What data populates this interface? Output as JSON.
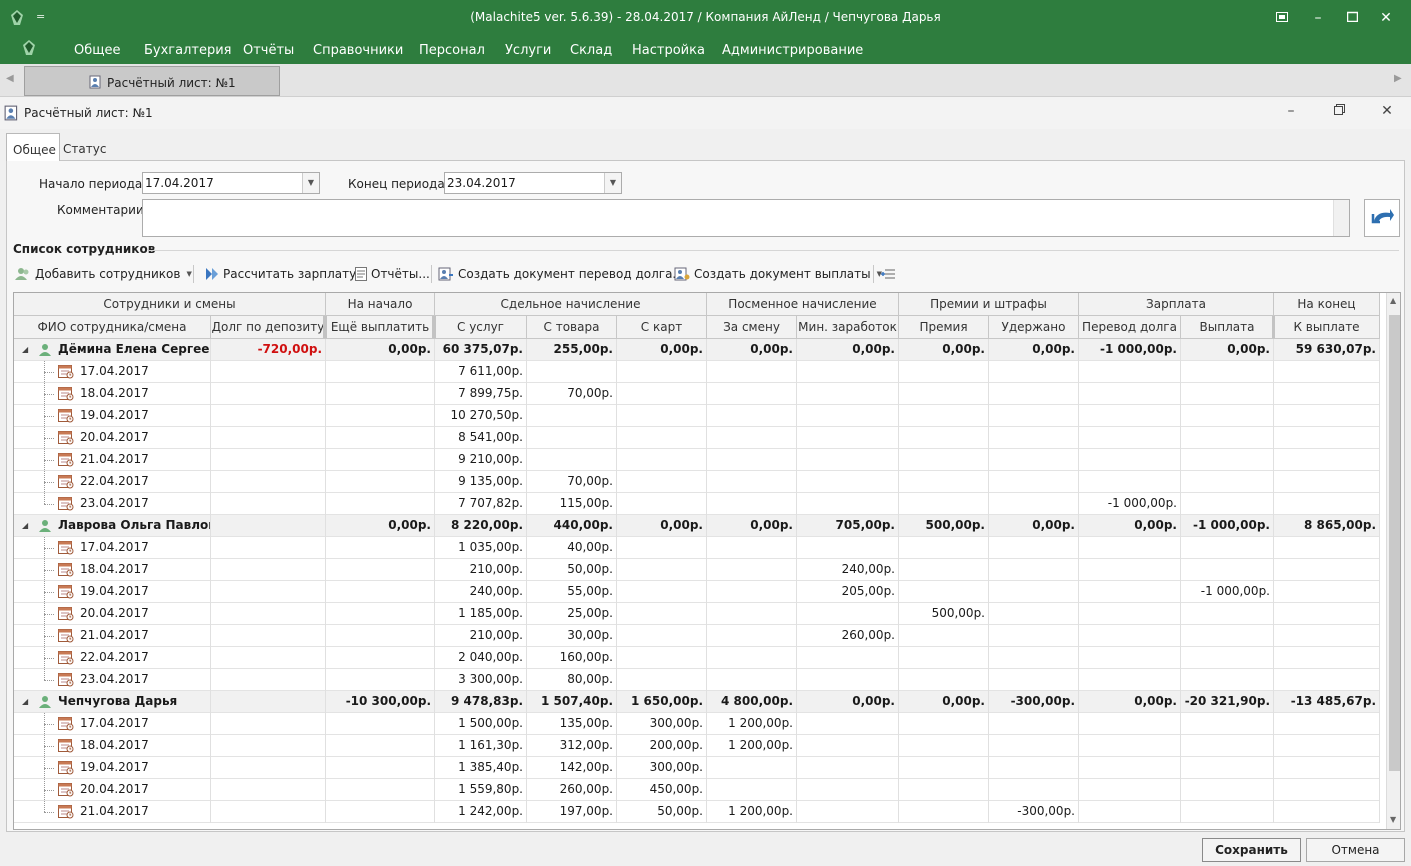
{
  "window": {
    "title": "(Malachite5 ver. 5.6.39) - 28.04.2017 / Компания АйЛенд / Чепчугова Дарья",
    "quick_access": "="
  },
  "menu": [
    "Общее",
    "Бухгалтерия",
    "Отчёты",
    "Справочники",
    "Персонал",
    "Услуги",
    "Склад",
    "Настройка",
    "Администрирование"
  ],
  "doc_tab": {
    "label": "Расчётный лист: №1"
  },
  "form": {
    "title": "Расчётный лист: №1",
    "tabs": [
      "Общее",
      "Статус"
    ],
    "start_label": "Начало периода:",
    "start_value": "17.04.2017",
    "end_label": "Конец периода:",
    "end_value": "23.04.2017",
    "comment_label": "Комментарии:",
    "comment_value": "",
    "section_title": "Список сотрудников"
  },
  "toolbar": {
    "add": "Добавить сотрудников",
    "calc": "Рассчитать зарплату",
    "reports": "Отчёты...",
    "debt_doc": "Создать документ перевод долга...",
    "pay_doc": "Создать документ выплаты"
  },
  "grid": {
    "bands": [
      "Сотрудники и смены",
      "На начало",
      "Сдельное начисление",
      "Посменное начисление",
      "Премии и штрафы",
      "Зарплата",
      "На конец"
    ],
    "columns": [
      "ФИО сотрудника/смена",
      "Долг по депозиту",
      "Ещё выплатить",
      "С услуг",
      "С товара",
      "С карт",
      "За смену",
      "Мин. заработок",
      "Премия",
      "Удержано",
      "Перевод долга",
      "Выплата",
      "К выплате"
    ],
    "employees": [
      {
        "name": "Дёмина Елена Сергеевна",
        "values": [
          "-720,00р.",
          "0,00р.",
          "60 375,07р.",
          "255,00р.",
          "0,00р.",
          "0,00р.",
          "0,00р.",
          "0,00р.",
          "0,00р.",
          "-1 000,00р.",
          "0,00р.",
          "59 630,07р."
        ],
        "shifts": [
          {
            "date": "17.04.2017",
            "values": [
              "",
              "",
              "7 611,00р.",
              "",
              "",
              "",
              "",
              "",
              "",
              "",
              "",
              ""
            ]
          },
          {
            "date": "18.04.2017",
            "values": [
              "",
              "",
              "7 899,75р.",
              "70,00р.",
              "",
              "",
              "",
              "",
              "",
              "",
              "",
              ""
            ]
          },
          {
            "date": "19.04.2017",
            "values": [
              "",
              "",
              "10 270,50р.",
              "",
              "",
              "",
              "",
              "",
              "",
              "",
              "",
              ""
            ]
          },
          {
            "date": "20.04.2017",
            "values": [
              "",
              "",
              "8 541,00р.",
              "",
              "",
              "",
              "",
              "",
              "",
              "",
              "",
              ""
            ]
          },
          {
            "date": "21.04.2017",
            "values": [
              "",
              "",
              "9 210,00р.",
              "",
              "",
              "",
              "",
              "",
              "",
              "",
              "",
              ""
            ]
          },
          {
            "date": "22.04.2017",
            "values": [
              "",
              "",
              "9 135,00р.",
              "70,00р.",
              "",
              "",
              "",
              "",
              "",
              "",
              "",
              ""
            ]
          },
          {
            "date": "23.04.2017",
            "values": [
              "",
              "",
              "7 707,82р.",
              "115,00р.",
              "",
              "",
              "",
              "",
              "",
              "-1 000,00р.",
              "",
              ""
            ]
          }
        ]
      },
      {
        "name": "Лаврова Ольга Павловна",
        "values": [
          "",
          "0,00р.",
          "8 220,00р.",
          "440,00р.",
          "0,00р.",
          "0,00р.",
          "705,00р.",
          "500,00р.",
          "0,00р.",
          "0,00р.",
          "-1 000,00р.",
          "8 865,00р."
        ],
        "shifts": [
          {
            "date": "17.04.2017",
            "values": [
              "",
              "",
              "1 035,00р.",
              "40,00р.",
              "",
              "",
              "",
              "",
              "",
              "",
              "",
              ""
            ]
          },
          {
            "date": "18.04.2017",
            "values": [
              "",
              "",
              "210,00р.",
              "50,00р.",
              "",
              "",
              "240,00р.",
              "",
              "",
              "",
              "",
              ""
            ]
          },
          {
            "date": "19.04.2017",
            "values": [
              "",
              "",
              "240,00р.",
              "55,00р.",
              "",
              "",
              "205,00р.",
              "",
              "",
              "",
              "-1 000,00р.",
              ""
            ]
          },
          {
            "date": "20.04.2017",
            "values": [
              "",
              "",
              "1 185,00р.",
              "25,00р.",
              "",
              "",
              "",
              "500,00р.",
              "",
              "",
              "",
              ""
            ]
          },
          {
            "date": "21.04.2017",
            "values": [
              "",
              "",
              "210,00р.",
              "30,00р.",
              "",
              "",
              "260,00р.",
              "",
              "",
              "",
              "",
              ""
            ]
          },
          {
            "date": "22.04.2017",
            "values": [
              "",
              "",
              "2 040,00р.",
              "160,00р.",
              "",
              "",
              "",
              "",
              "",
              "",
              "",
              ""
            ]
          },
          {
            "date": "23.04.2017",
            "values": [
              "",
              "",
              "3 300,00р.",
              "80,00р.",
              "",
              "",
              "",
              "",
              "",
              "",
              "",
              ""
            ]
          }
        ]
      },
      {
        "name": "Чепчугова Дарья",
        "values": [
          "",
          "-10 300,00р.",
          "9 478,83р.",
          "1 507,40р.",
          "1 650,00р.",
          "4 800,00р.",
          "0,00р.",
          "0,00р.",
          "-300,00р.",
          "0,00р.",
          "-20 321,90р.",
          "-13 485,67р."
        ],
        "shifts": [
          {
            "date": "17.04.2017",
            "values": [
              "",
              "",
              "1 500,00р.",
              "135,00р.",
              "300,00р.",
              "1 200,00р.",
              "",
              "",
              "",
              "",
              "",
              ""
            ]
          },
          {
            "date": "18.04.2017",
            "values": [
              "",
              "",
              "1 161,30р.",
              "312,00р.",
              "200,00р.",
              "1 200,00р.",
              "",
              "",
              "",
              "",
              "",
              ""
            ]
          },
          {
            "date": "19.04.2017",
            "values": [
              "",
              "",
              "1 385,40р.",
              "142,00р.",
              "300,00р.",
              "",
              "",
              "",
              "",
              "",
              "",
              ""
            ]
          },
          {
            "date": "20.04.2017",
            "values": [
              "",
              "",
              "1 559,80р.",
              "260,00р.",
              "450,00р.",
              "",
              "",
              "",
              "",
              "",
              "",
              ""
            ]
          },
          {
            "date": "21.04.2017",
            "values": [
              "",
              "",
              "1 242,00р.",
              "197,00р.",
              "50,00р.",
              "1 200,00р.",
              "",
              "",
              "-300,00р.",
              "",
              "",
              ""
            ]
          }
        ]
      }
    ]
  },
  "buttons": {
    "save": "Сохранить",
    "cancel": "Отмена"
  },
  "colors": {
    "accent": "#2e7d3e",
    "negative": "#d01010"
  }
}
